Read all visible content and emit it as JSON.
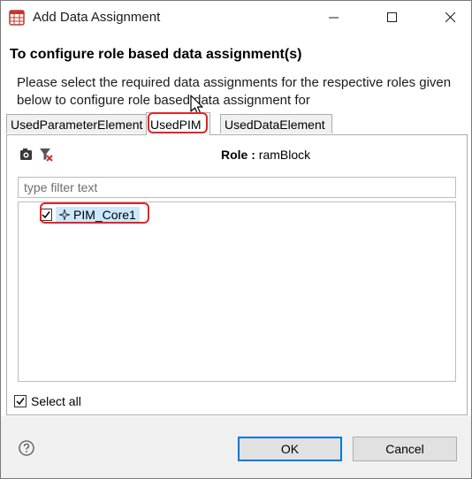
{
  "window": {
    "title": "Add Data Assignment"
  },
  "header": {
    "title": "To configure role based data assignment(s)",
    "description": "Please select the required data assignments for the respective roles given below to configure role based data assignment for"
  },
  "tabs": [
    {
      "label": "UsedParameterElement",
      "selected": false
    },
    {
      "label": "UsedPIM",
      "selected": true
    },
    {
      "label": "UsedDataElement",
      "selected": false
    }
  ],
  "panel": {
    "role_label": "Role :",
    "role_value": "ramBlock",
    "filter_placeholder": "type filter text",
    "tree_items": [
      {
        "label": "PIM_Core1",
        "checked": true,
        "icon": "pim-element-icon"
      }
    ],
    "select_all_label": "Select all",
    "select_all_checked": true
  },
  "footer": {
    "ok_label": "OK",
    "cancel_label": "Cancel"
  },
  "colors": {
    "highlight_outline": "#e32424",
    "selection_bg": "#cce8ff",
    "default_button_border": "#0078d7",
    "footer_bg": "#f0f0f0"
  },
  "icons": {
    "app": "app-grid-icon",
    "toolbar": [
      "refresh-icon",
      "clear-filter-icon"
    ],
    "help": "help-icon"
  }
}
